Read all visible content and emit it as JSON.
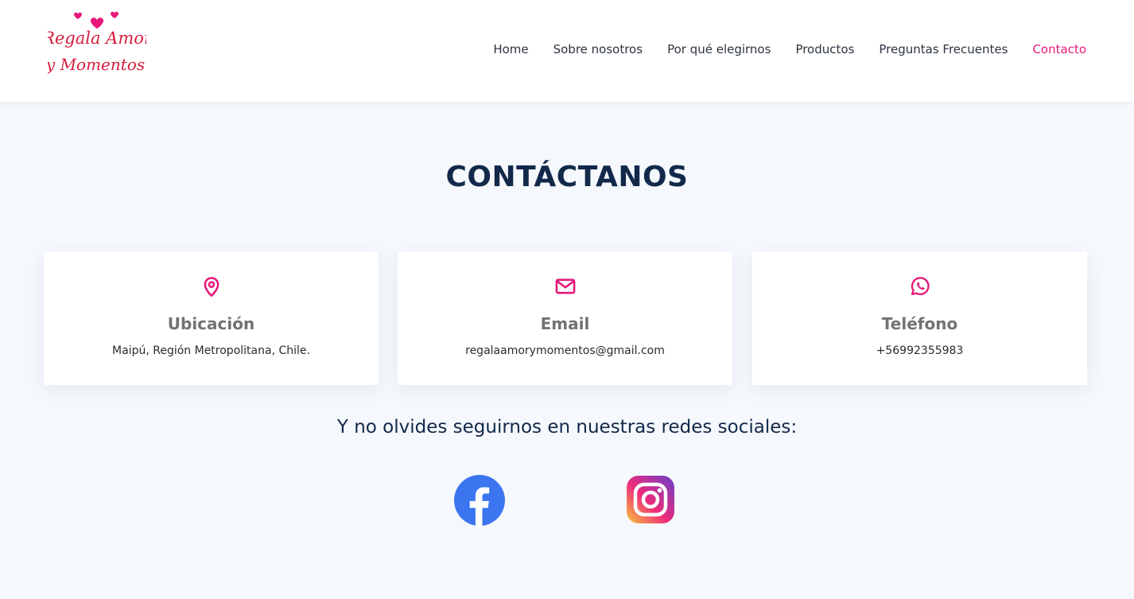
{
  "brand": {
    "logo_line1": "Regala Amor",
    "logo_line2": "y Momentos",
    "logo_color": "#d81c3f",
    "heart_color": "#e6197a"
  },
  "nav": {
    "items": [
      {
        "label": "Home"
      },
      {
        "label": "Sobre nosotros"
      },
      {
        "label": "Por qué elegirnos"
      },
      {
        "label": "Productos"
      },
      {
        "label": "Preguntas Frecuentes"
      },
      {
        "label": "Contacto",
        "active": true
      }
    ],
    "active_color": "#e6197a"
  },
  "contact": {
    "title": "CONTÁCTANOS",
    "cards": [
      {
        "icon": "location-pin-icon",
        "title": "Ubicación",
        "text": "Maipú, Región Metropolitana, Chile."
      },
      {
        "icon": "envelope-icon",
        "title": "Email",
        "text": "regalaamorymomentos@gmail.com"
      },
      {
        "icon": "whatsapp-icon",
        "title": "Teléfono",
        "text": "+56992355983"
      }
    ],
    "icon_color": "#e6197a"
  },
  "social": {
    "heading": "Y no olvides seguirnos en nuestras redes sociales:",
    "links": [
      {
        "icon": "facebook-icon",
        "color": "#3b76f0"
      },
      {
        "icon": "instagram-icon",
        "colors": [
          "#f9c73d",
          "#ee2a7b",
          "#6a3fc8"
        ]
      }
    ]
  },
  "colors": {
    "page_bg": "#f5f8fc",
    "heading": "#12294a",
    "card_title": "#727272"
  }
}
